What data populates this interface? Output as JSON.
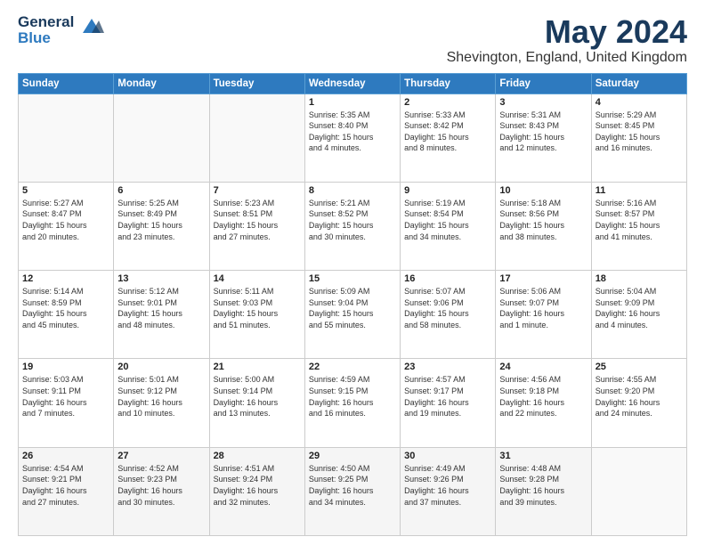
{
  "header": {
    "logo_line1": "General",
    "logo_line2": "Blue",
    "month": "May 2024",
    "location": "Shevington, England, United Kingdom"
  },
  "weekdays": [
    "Sunday",
    "Monday",
    "Tuesday",
    "Wednesday",
    "Thursday",
    "Friday",
    "Saturday"
  ],
  "weeks": [
    [
      {
        "day": "",
        "info": ""
      },
      {
        "day": "",
        "info": ""
      },
      {
        "day": "",
        "info": ""
      },
      {
        "day": "1",
        "info": "Sunrise: 5:35 AM\nSunset: 8:40 PM\nDaylight: 15 hours\nand 4 minutes."
      },
      {
        "day": "2",
        "info": "Sunrise: 5:33 AM\nSunset: 8:42 PM\nDaylight: 15 hours\nand 8 minutes."
      },
      {
        "day": "3",
        "info": "Sunrise: 5:31 AM\nSunset: 8:43 PM\nDaylight: 15 hours\nand 12 minutes."
      },
      {
        "day": "4",
        "info": "Sunrise: 5:29 AM\nSunset: 8:45 PM\nDaylight: 15 hours\nand 16 minutes."
      }
    ],
    [
      {
        "day": "5",
        "info": "Sunrise: 5:27 AM\nSunset: 8:47 PM\nDaylight: 15 hours\nand 20 minutes."
      },
      {
        "day": "6",
        "info": "Sunrise: 5:25 AM\nSunset: 8:49 PM\nDaylight: 15 hours\nand 23 minutes."
      },
      {
        "day": "7",
        "info": "Sunrise: 5:23 AM\nSunset: 8:51 PM\nDaylight: 15 hours\nand 27 minutes."
      },
      {
        "day": "8",
        "info": "Sunrise: 5:21 AM\nSunset: 8:52 PM\nDaylight: 15 hours\nand 30 minutes."
      },
      {
        "day": "9",
        "info": "Sunrise: 5:19 AM\nSunset: 8:54 PM\nDaylight: 15 hours\nand 34 minutes."
      },
      {
        "day": "10",
        "info": "Sunrise: 5:18 AM\nSunset: 8:56 PM\nDaylight: 15 hours\nand 38 minutes."
      },
      {
        "day": "11",
        "info": "Sunrise: 5:16 AM\nSunset: 8:57 PM\nDaylight: 15 hours\nand 41 minutes."
      }
    ],
    [
      {
        "day": "12",
        "info": "Sunrise: 5:14 AM\nSunset: 8:59 PM\nDaylight: 15 hours\nand 45 minutes."
      },
      {
        "day": "13",
        "info": "Sunrise: 5:12 AM\nSunset: 9:01 PM\nDaylight: 15 hours\nand 48 minutes."
      },
      {
        "day": "14",
        "info": "Sunrise: 5:11 AM\nSunset: 9:03 PM\nDaylight: 15 hours\nand 51 minutes."
      },
      {
        "day": "15",
        "info": "Sunrise: 5:09 AM\nSunset: 9:04 PM\nDaylight: 15 hours\nand 55 minutes."
      },
      {
        "day": "16",
        "info": "Sunrise: 5:07 AM\nSunset: 9:06 PM\nDaylight: 15 hours\nand 58 minutes."
      },
      {
        "day": "17",
        "info": "Sunrise: 5:06 AM\nSunset: 9:07 PM\nDaylight: 16 hours\nand 1 minute."
      },
      {
        "day": "18",
        "info": "Sunrise: 5:04 AM\nSunset: 9:09 PM\nDaylight: 16 hours\nand 4 minutes."
      }
    ],
    [
      {
        "day": "19",
        "info": "Sunrise: 5:03 AM\nSunset: 9:11 PM\nDaylight: 16 hours\nand 7 minutes."
      },
      {
        "day": "20",
        "info": "Sunrise: 5:01 AM\nSunset: 9:12 PM\nDaylight: 16 hours\nand 10 minutes."
      },
      {
        "day": "21",
        "info": "Sunrise: 5:00 AM\nSunset: 9:14 PM\nDaylight: 16 hours\nand 13 minutes."
      },
      {
        "day": "22",
        "info": "Sunrise: 4:59 AM\nSunset: 9:15 PM\nDaylight: 16 hours\nand 16 minutes."
      },
      {
        "day": "23",
        "info": "Sunrise: 4:57 AM\nSunset: 9:17 PM\nDaylight: 16 hours\nand 19 minutes."
      },
      {
        "day": "24",
        "info": "Sunrise: 4:56 AM\nSunset: 9:18 PM\nDaylight: 16 hours\nand 22 minutes."
      },
      {
        "day": "25",
        "info": "Sunrise: 4:55 AM\nSunset: 9:20 PM\nDaylight: 16 hours\nand 24 minutes."
      }
    ],
    [
      {
        "day": "26",
        "info": "Sunrise: 4:54 AM\nSunset: 9:21 PM\nDaylight: 16 hours\nand 27 minutes."
      },
      {
        "day": "27",
        "info": "Sunrise: 4:52 AM\nSunset: 9:23 PM\nDaylight: 16 hours\nand 30 minutes."
      },
      {
        "day": "28",
        "info": "Sunrise: 4:51 AM\nSunset: 9:24 PM\nDaylight: 16 hours\nand 32 minutes."
      },
      {
        "day": "29",
        "info": "Sunrise: 4:50 AM\nSunset: 9:25 PM\nDaylight: 16 hours\nand 34 minutes."
      },
      {
        "day": "30",
        "info": "Sunrise: 4:49 AM\nSunset: 9:26 PM\nDaylight: 16 hours\nand 37 minutes."
      },
      {
        "day": "31",
        "info": "Sunrise: 4:48 AM\nSunset: 9:28 PM\nDaylight: 16 hours\nand 39 minutes."
      },
      {
        "day": "",
        "info": ""
      }
    ]
  ]
}
